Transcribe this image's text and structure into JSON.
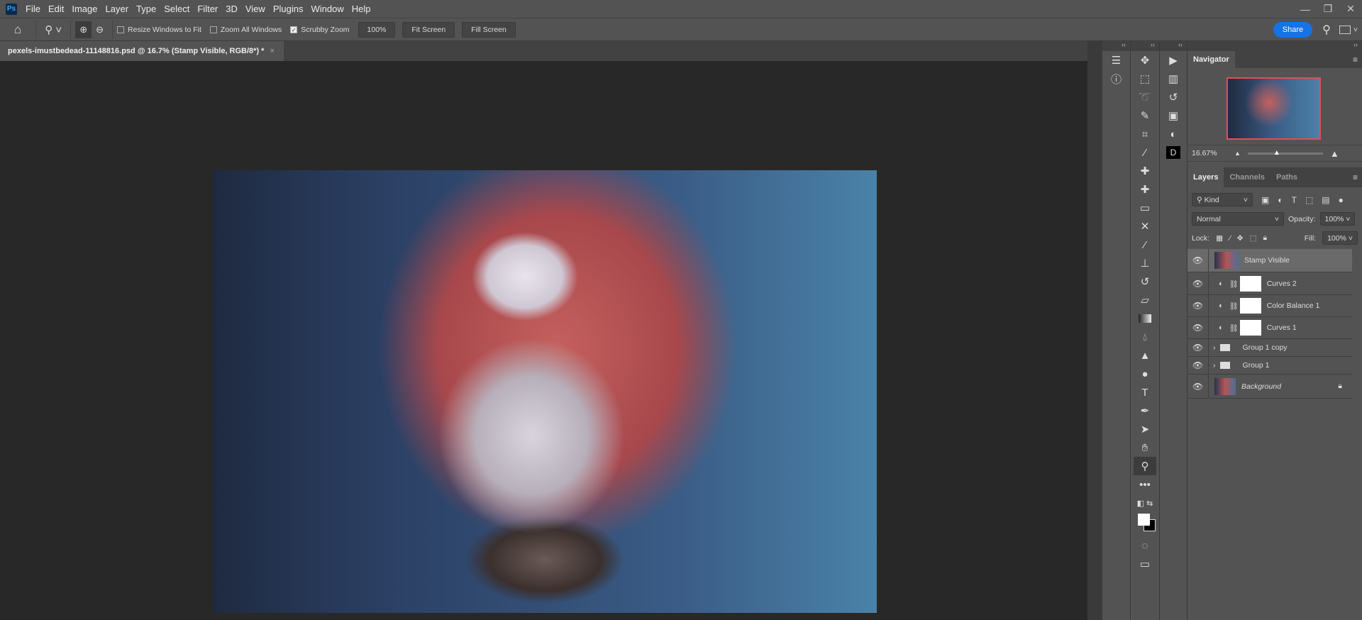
{
  "app": {
    "logo": "Ps",
    "menu": [
      "File",
      "Edit",
      "Image",
      "Layer",
      "Type",
      "Select",
      "Filter",
      "3D",
      "View",
      "Plugins",
      "Window",
      "Help"
    ],
    "window_controls": {
      "minimize": "—",
      "restore": "❐",
      "close": "✕"
    }
  },
  "options": {
    "resize_windows": "Resize Windows to Fit",
    "resize_checked": false,
    "zoom_all": "Zoom All Windows",
    "zoom_all_checked": false,
    "scrubby": "Scrubby Zoom",
    "scrubby_checked": true,
    "zoom_100": "100%",
    "fit_screen": "Fit Screen",
    "fill_screen": "Fill Screen",
    "share": "Share"
  },
  "document": {
    "tab_title": "pexels-imustbedead-11148816.psd @ 16.7% (Stamp Visible, RGB/8*) *",
    "close": "×"
  },
  "navigator": {
    "title": "Navigator",
    "zoom": "16.67%"
  },
  "layers_panel": {
    "tabs": [
      "Layers",
      "Channels",
      "Paths"
    ],
    "filter": "Kind",
    "blend_mode": "Normal",
    "opacity_label": "Opacity:",
    "opacity": "100%",
    "lock_label": "Lock:",
    "fill_label": "Fill:",
    "fill": "100%",
    "layers": [
      {
        "name": "Stamp Visible",
        "type": "pixel",
        "selected": true
      },
      {
        "name": "Curves 2",
        "type": "adjustment"
      },
      {
        "name": "Color Balance 1",
        "type": "adjustment"
      },
      {
        "name": "Curves 1",
        "type": "adjustment"
      },
      {
        "name": "Group 1 copy",
        "type": "group"
      },
      {
        "name": "Group 1",
        "type": "group"
      },
      {
        "name": "Background",
        "type": "background",
        "locked": true
      }
    ]
  },
  "colors": {
    "accent": "#1473e6",
    "nav_frame": "#e05050"
  }
}
